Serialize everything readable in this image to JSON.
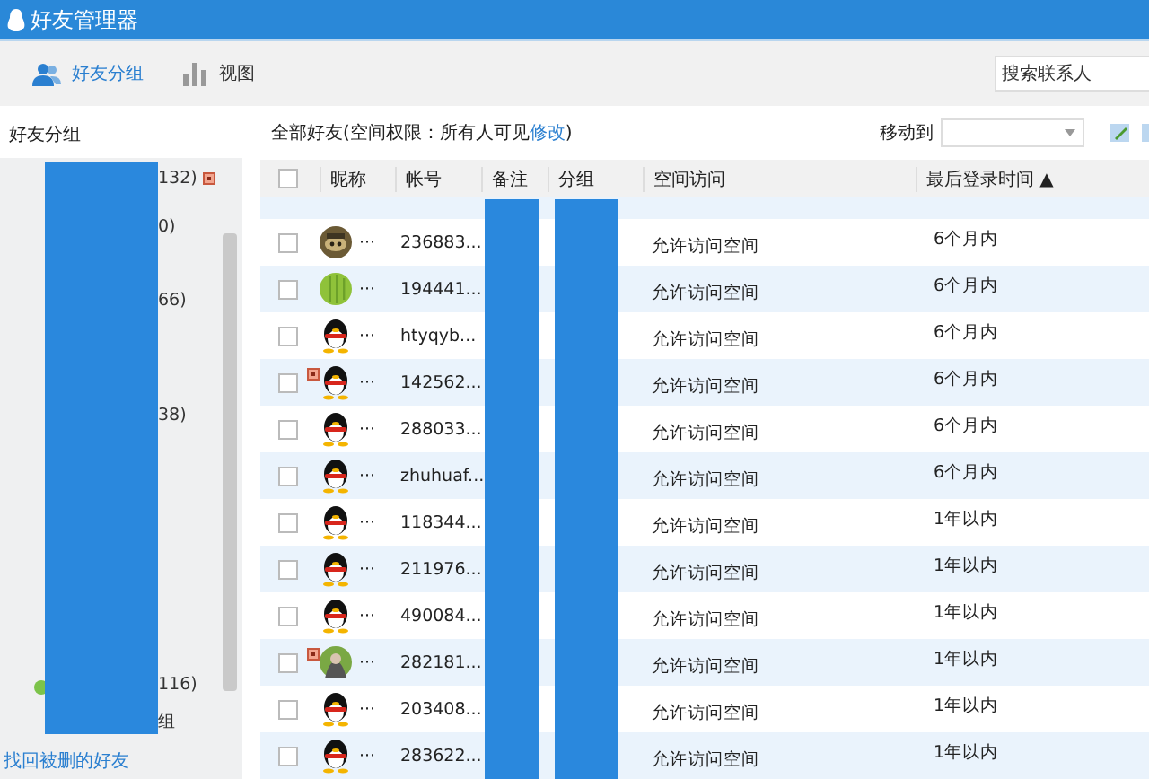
{
  "window": {
    "title": "好友管理器"
  },
  "tabs": [
    {
      "label": "好友分组",
      "selected": true
    },
    {
      "label": "视图",
      "selected": false
    }
  ],
  "search": {
    "placeholder": "搜索联系人"
  },
  "sidebar": {
    "title": "好友分组",
    "redacted": true,
    "groups": [
      {
        "text": "132)",
        "flagged": true
      },
      {
        "text": "0)",
        "flagged": false
      },
      {
        "text": "66)",
        "flagged": false
      },
      {
        "text": "38)",
        "flagged": false
      },
      {
        "text": "116)",
        "flagged": false
      },
      {
        "text": "组",
        "flagged": false
      }
    ],
    "link": "找回被删的好友"
  },
  "main": {
    "title": "全部好友(空间权限：所有人可见",
    "title_link": "修改",
    "title_end": ")",
    "move_label": "移动到"
  },
  "table": {
    "columns": [
      {
        "label": "昵称",
        "redacted": false
      },
      {
        "label": "帐号",
        "redacted": false
      },
      {
        "label": "备注",
        "redacted": true
      },
      {
        "label": "分组",
        "redacted": true
      },
      {
        "label": "空间访问",
        "redacted": false
      },
      {
        "label": "最后登录时间",
        "redacted": false
      }
    ],
    "sort_indicator": "▲",
    "all_checked": false,
    "rows": [
      {
        "checked": false,
        "flagged": false,
        "kind": "photo-brown",
        "nickname": "···",
        "account": "236883...",
        "space": "允许访问空间",
        "last_login": "6个月内"
      },
      {
        "checked": false,
        "flagged": false,
        "kind": "photo-green",
        "nickname": "···",
        "account": "194441...",
        "space": "允许访问空间",
        "last_login": "6个月内"
      },
      {
        "checked": false,
        "flagged": false,
        "kind": "penguin",
        "nickname": "···",
        "account": "htyqyb...",
        "space": "允许访问空间",
        "last_login": "6个月内"
      },
      {
        "checked": false,
        "flagged": true,
        "kind": "penguin",
        "nickname": "···",
        "account": "142562...",
        "space": "允许访问空间",
        "last_login": "6个月内"
      },
      {
        "checked": false,
        "flagged": false,
        "kind": "penguin",
        "nickname": "···",
        "account": "288033...",
        "space": "允许访问空间",
        "last_login": "6个月内"
      },
      {
        "checked": false,
        "flagged": false,
        "kind": "penguin",
        "nickname": "···",
        "account": "zhuhuaf...",
        "space": "允许访问空间",
        "last_login": "6个月内"
      },
      {
        "checked": false,
        "flagged": false,
        "kind": "penguin",
        "nickname": "···",
        "account": "118344...",
        "space": "允许访问空间",
        "last_login": "1年以内"
      },
      {
        "checked": false,
        "flagged": false,
        "kind": "penguin",
        "nickname": "···",
        "account": "211976...",
        "space": "允许访问空间",
        "last_login": "1年以内"
      },
      {
        "checked": false,
        "flagged": false,
        "kind": "penguin",
        "nickname": "···",
        "account": "490084...",
        "space": "允许访问空间",
        "last_login": "1年以内"
      },
      {
        "checked": false,
        "flagged": true,
        "kind": "photo-person",
        "nickname": "···",
        "account": "282181...",
        "space": "允许访问空间",
        "last_login": "1年以内"
      },
      {
        "checked": false,
        "flagged": false,
        "kind": "penguin",
        "nickname": "···",
        "account": "203408...",
        "space": "允许访问空间",
        "last_login": "1年以内"
      },
      {
        "checked": false,
        "flagged": false,
        "kind": "penguin",
        "nickname": "···",
        "account": "283622...",
        "space": "允许访问空间",
        "last_login": "1年以内"
      }
    ]
  }
}
